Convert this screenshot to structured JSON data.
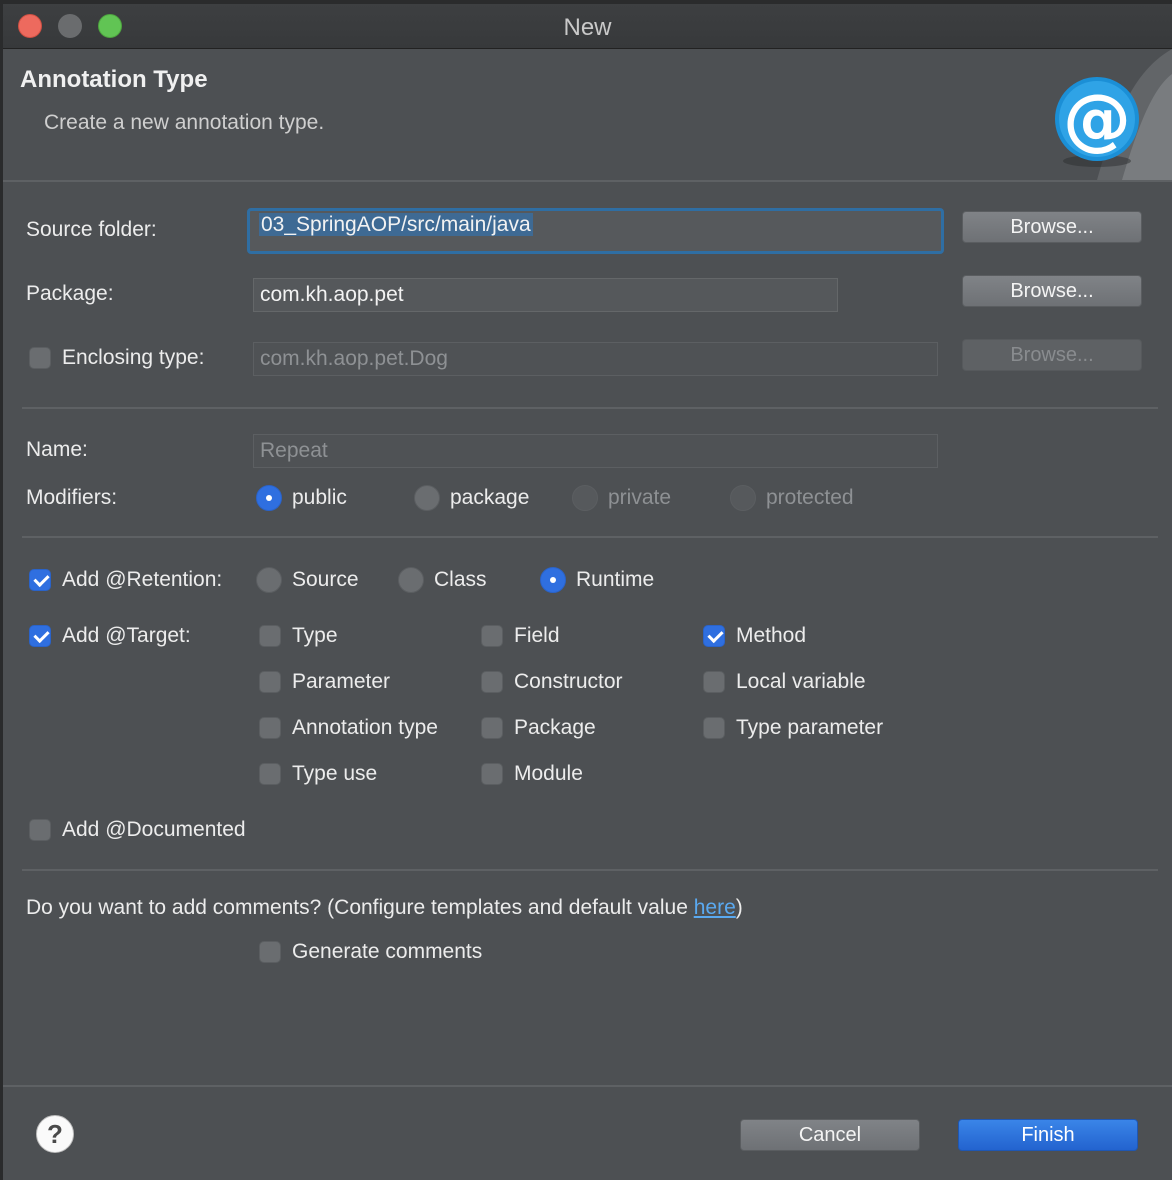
{
  "window": {
    "title": "New"
  },
  "header": {
    "title": "Annotation Type",
    "subtitle": "Create a new annotation type.",
    "banner_icon": "at-sign-icon"
  },
  "form": {
    "source_folder": {
      "label": "Source folder:",
      "value": "03_SpringAOP/src/main/java",
      "browse": "Browse..."
    },
    "package": {
      "label": "Package:",
      "value": "com.kh.aop.pet",
      "browse": "Browse..."
    },
    "enclosing_type": {
      "label": "Enclosing type:",
      "value": "com.kh.aop.pet.Dog",
      "browse": "Browse...",
      "checked": false
    },
    "name": {
      "label": "Name:",
      "placeholder": "Repeat"
    },
    "modifiers": {
      "label": "Modifiers:",
      "options": [
        "public",
        "package",
        "private",
        "protected"
      ],
      "selected": "public"
    },
    "retention": {
      "label": "Add @Retention:",
      "checked": true,
      "options": [
        "Source",
        "Class",
        "Runtime"
      ],
      "selected": "Runtime"
    },
    "target": {
      "label": "Add @Target:",
      "checked": true,
      "options": [
        {
          "label": "Type",
          "checked": false
        },
        {
          "label": "Field",
          "checked": false
        },
        {
          "label": "Method",
          "checked": true
        },
        {
          "label": "Parameter",
          "checked": false
        },
        {
          "label": "Constructor",
          "checked": false
        },
        {
          "label": "Local variable",
          "checked": false
        },
        {
          "label": "Annotation type",
          "checked": false
        },
        {
          "label": "Package",
          "checked": false
        },
        {
          "label": "Type parameter",
          "checked": false
        },
        {
          "label": "Type use",
          "checked": false
        },
        {
          "label": "Module",
          "checked": false
        }
      ]
    },
    "documented": {
      "label": "Add @Documented",
      "checked": false
    },
    "comments": {
      "question": "Do you want to add comments? (Configure templates and default value ",
      "link": "here",
      "close": ")",
      "generate_label": "Generate comments",
      "generate_checked": false
    }
  },
  "footer": {
    "help": "?",
    "cancel": "Cancel",
    "finish": "Finish"
  },
  "colors": {
    "accent": "#2f6fe0",
    "background": "#4d5053",
    "link": "#5aa9f0"
  }
}
